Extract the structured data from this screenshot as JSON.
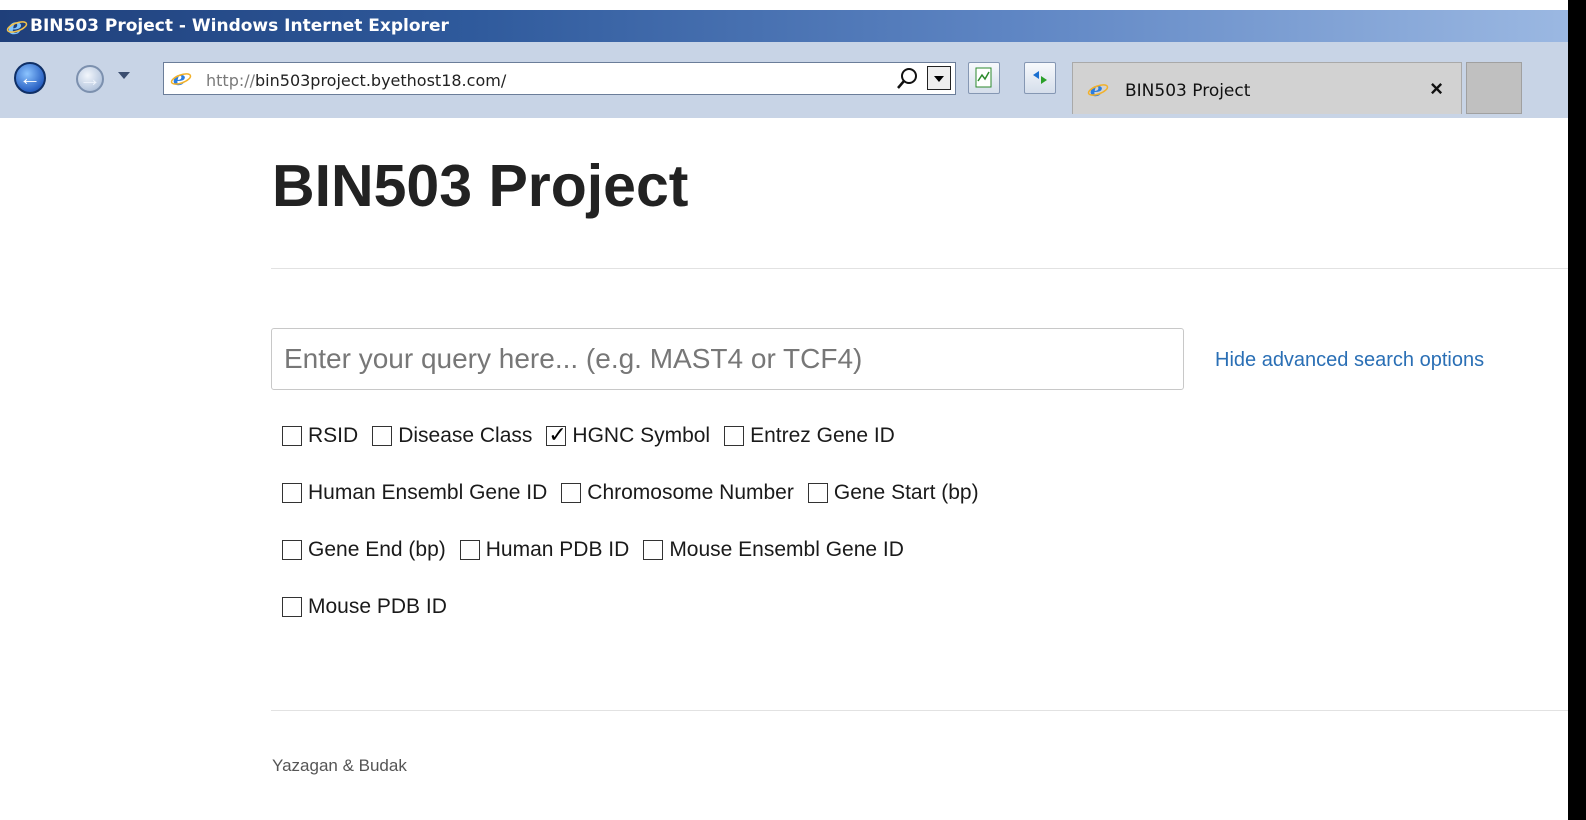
{
  "window": {
    "title": "BIN503 Project - Windows Internet Explorer"
  },
  "browser": {
    "url_protocol": "http://",
    "url_rest": "bin503project.byethost18.com/",
    "tab_title": "BIN503 Project",
    "tab_close": "×"
  },
  "page": {
    "heading": "BIN503 Project",
    "search": {
      "placeholder": "Enter your query here... (e.g. MAST4 or TCF4)",
      "value": ""
    },
    "advanced_link": "Hide advanced search options",
    "options": [
      [
        {
          "label": "RSID",
          "checked": false
        },
        {
          "label": "Disease Class",
          "checked": false
        },
        {
          "label": "HGNC Symbol",
          "checked": true
        },
        {
          "label": "Entrez Gene ID",
          "checked": false
        }
      ],
      [
        {
          "label": "Human Ensembl Gene ID",
          "checked": false
        },
        {
          "label": "Chromosome Number",
          "checked": false
        },
        {
          "label": "Gene Start (bp)",
          "checked": false
        }
      ],
      [
        {
          "label": "Gene End (bp)",
          "checked": false
        },
        {
          "label": "Human PDB ID",
          "checked": false
        },
        {
          "label": "Mouse Ensembl Gene ID",
          "checked": false
        }
      ],
      [
        {
          "label": "Mouse PDB ID",
          "checked": false
        }
      ]
    ],
    "footer": "Yazagan & Budak"
  }
}
